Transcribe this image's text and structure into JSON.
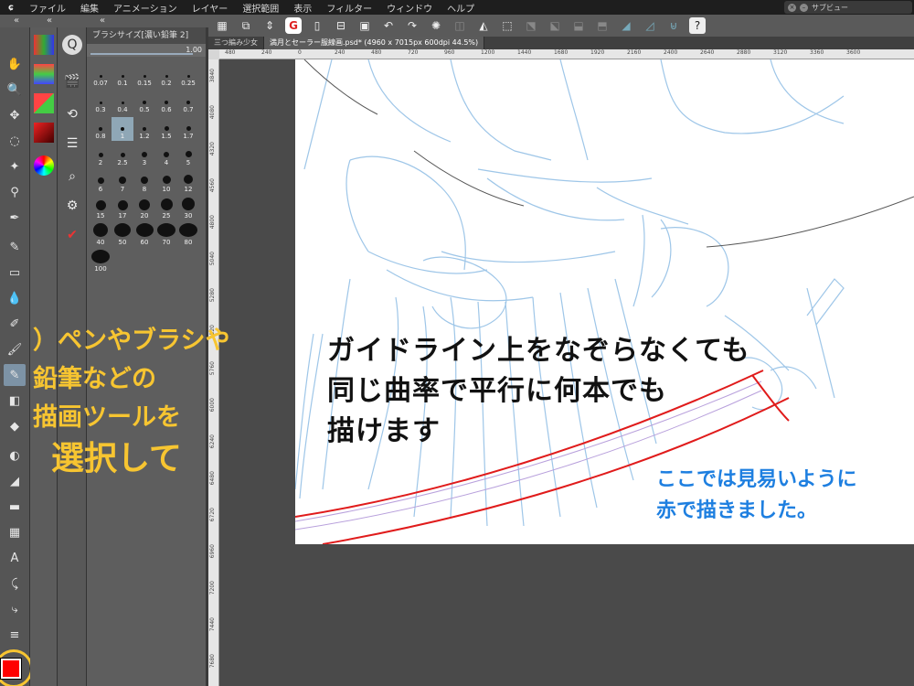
{
  "menubar": {
    "logo": "ɕ",
    "items": [
      "ファイル",
      "編集",
      "アニメーション",
      "レイヤー",
      "選択範囲",
      "表示",
      "フィルター",
      "ウィンドウ",
      "ヘルプ"
    ],
    "subview": "サブビュー"
  },
  "collapse": {
    "left": "«",
    "right": "«",
    "mid": "«"
  },
  "brush_panel": {
    "title": "ブラシサイズ[濃い鉛筆 2]",
    "slider_value": "1.00",
    "sizes": [
      "0.07",
      "0.1",
      "0.15",
      "0.2",
      "0.25",
      "0.3",
      "0.4",
      "0.5",
      "0.6",
      "0.7",
      "0.8",
      "1",
      "1.2",
      "1.5",
      "1.7",
      "2",
      "2.5",
      "3",
      "4",
      "5",
      "6",
      "7",
      "8",
      "10",
      "12",
      "15",
      "17",
      "20",
      "25",
      "30",
      "40",
      "50",
      "60",
      "70",
      "80",
      "100"
    ],
    "selected": "1"
  },
  "tabs": [
    "三つ編み少女",
    "満月とセーラー服線画.psd* (4960 x 7015px 600dpi 44.5%)"
  ],
  "ruler_top": [
    "480",
    "240",
    "0",
    "240",
    "480",
    "720",
    "960",
    "1200",
    "1440",
    "1680",
    "1920",
    "2160",
    "2400",
    "2640",
    "2880",
    "3120",
    "3360",
    "3600"
  ],
  "ruler_left": [
    "3840",
    "4080",
    "4320",
    "4560",
    "4800",
    "5040",
    "5280",
    "5520",
    "5760",
    "6000",
    "6240",
    "6480",
    "6720",
    "6960",
    "7200",
    "7440",
    "7680"
  ],
  "annotations": {
    "main": [
      "ガイドライン上をなぞらなくても",
      "同じ曲率で平行に何本でも",
      "描けます"
    ],
    "blue": [
      "ここでは見易いように",
      "赤で描きました。"
    ],
    "yellow": [
      "）ペンやブラシや",
      "鉛筆などの",
      "描画ツールを",
      "選択して"
    ]
  },
  "colors": {
    "accent": "#f7c531",
    "stroke": "#e01b1b",
    "guide": "#9ec6e8",
    "note_blue": "#1e7fe0"
  }
}
